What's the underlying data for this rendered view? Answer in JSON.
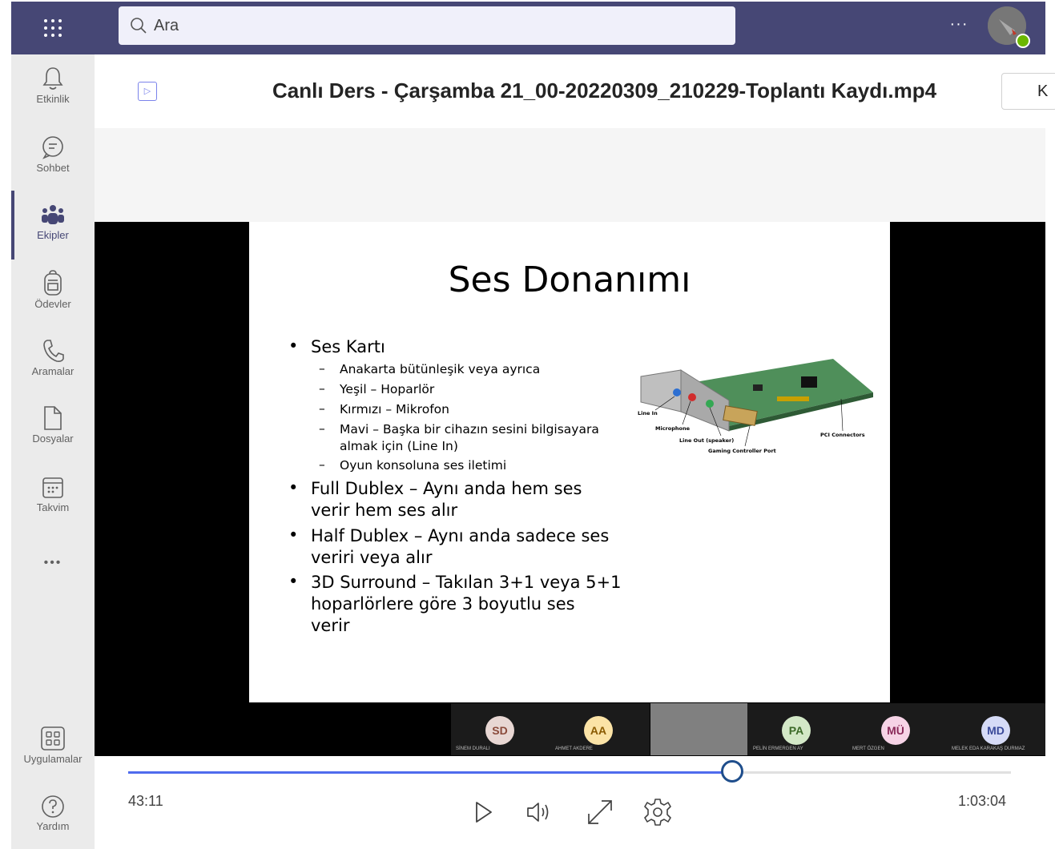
{
  "topbar": {
    "apps_icon": "grid-dots-icon",
    "search_placeholder": "Ara",
    "more_label": "···"
  },
  "rail": {
    "items": [
      {
        "label": "Etkinlik",
        "icon": "bell-icon"
      },
      {
        "label": "Sohbet",
        "icon": "chat-icon"
      },
      {
        "label": "Ekipler",
        "icon": "teams-icon",
        "active": true
      },
      {
        "label": "Ödevler",
        "icon": "backpack-icon"
      },
      {
        "label": "Aramalar",
        "icon": "phone-icon"
      },
      {
        "label": "Dosyalar",
        "icon": "file-icon"
      },
      {
        "label": "Takvim",
        "icon": "calendar-icon"
      }
    ],
    "more_label": "•••",
    "apps_label": "Uygulamalar",
    "help_label": "Yardım"
  },
  "header": {
    "title": "Canlı Ders - Çarşamba 21_00-20220309_210229-Toplantı Kaydı.mp4",
    "button_label": "K"
  },
  "slide": {
    "title": "Ses Donanımı",
    "bullets": [
      {
        "text": "Ses Kartı"
      },
      {
        "text": "Full Dublex – Aynı anda hem ses",
        "text2": "verir hem ses alır"
      },
      {
        "text": "Half Dublex – Aynı anda sadece ses",
        "text2": "veriri veya alır"
      },
      {
        "text": "3D Surround – Takılan 3+1 veya 5+1",
        "text2": "hoparlörlere göre 3 boyutlu ses",
        "text3": "verir"
      }
    ],
    "sub_bullets": [
      {
        "text": "Anakarta bütünleşik  veya ayrıca"
      },
      {
        "text": "Yeşil – Hoparlör"
      },
      {
        "text": "Kırmızı – Mikrofon"
      },
      {
        "text": "Mavi – Başka bir cihazın sesini bilgisayara",
        "text2": "almak için (Line In)"
      },
      {
        "text": "Oyun konsoluna ses iletimi"
      }
    ],
    "image_labels": {
      "line_in": "Line In",
      "microphone": "Microphone",
      "line_out": "Line Out (speaker)",
      "gaming": "Gaming Controller Port",
      "pci": "PCI Connectors"
    }
  },
  "participants": [
    {
      "initials": "SD",
      "name": "SİNEM DURALI",
      "color": "#e8d7d3",
      "text_color": "#8a4a3a"
    },
    {
      "initials": "AA",
      "name": "AHMET AKDERE",
      "color": "#fbe3a6",
      "text_color": "#8a5a00"
    },
    {
      "initials": "",
      "name": "",
      "color": "#808080",
      "text_color": "#808080"
    },
    {
      "initials": "PA",
      "name": "PELİN ERMERGEN AY",
      "color": "#d3e8c7",
      "text_color": "#3c6a28"
    },
    {
      "initials": "MÜ",
      "name": "MERT ÖZGEN",
      "color": "#f6d3e6",
      "text_color": "#8a2a5a"
    },
    {
      "initials": "MD",
      "name": "MELEK EDA KARAKAŞ DURMAZ",
      "color": "#d6dbf7",
      "text_color": "#3a4a9a"
    }
  ],
  "player": {
    "current_time": "43:11",
    "total_time": "1:03:04",
    "progress": 0.684,
    "play_icon": "play-icon",
    "volume_icon": "volume-icon",
    "fullscreen_icon": "expand-icon",
    "settings_icon": "gear-icon"
  }
}
